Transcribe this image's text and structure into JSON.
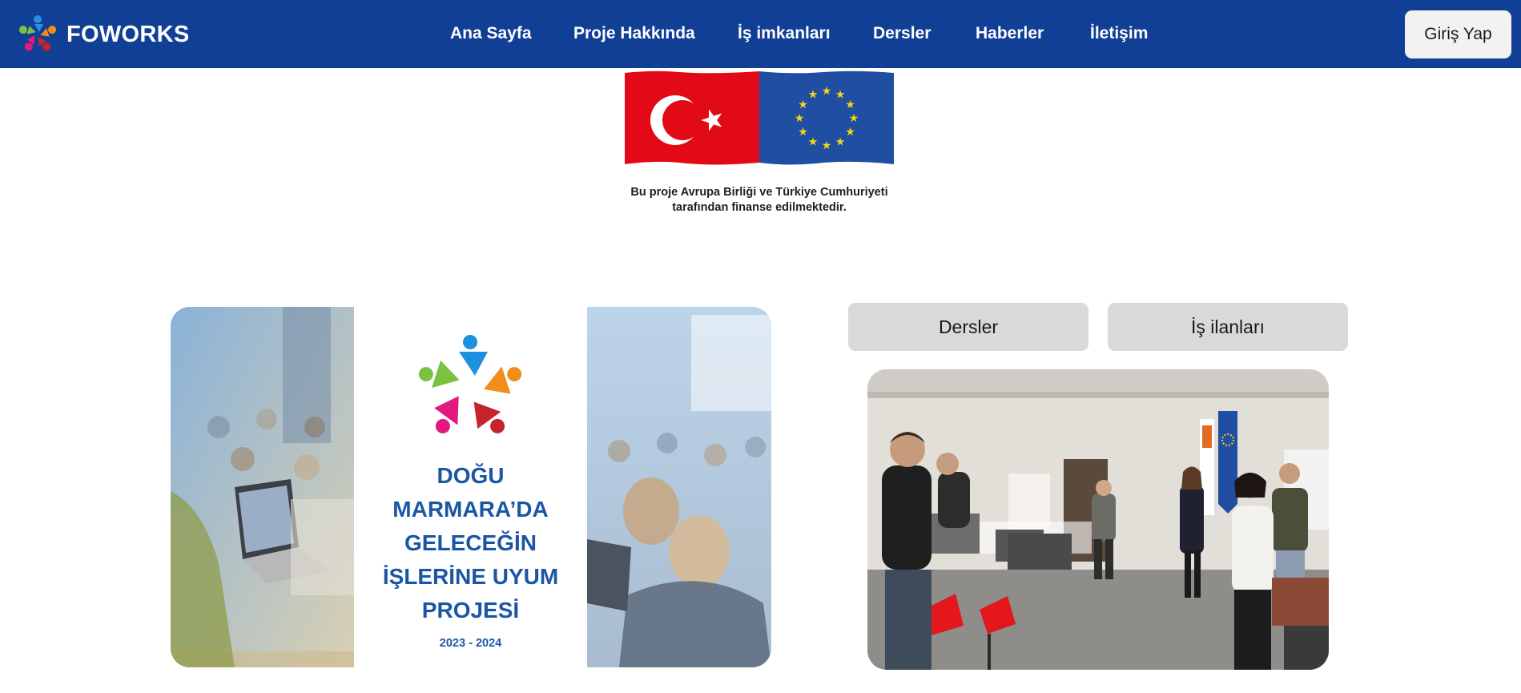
{
  "header": {
    "brand_name": "FOWORKS",
    "nav": [
      {
        "label": "Ana Sayfa"
      },
      {
        "label": "Proje Hakkında"
      },
      {
        "label": "İş imkanları"
      },
      {
        "label": "Dersler"
      },
      {
        "label": "Haberler"
      },
      {
        "label": "İletişim"
      }
    ],
    "login_label": "Giriş Yap"
  },
  "funding": {
    "note_line1": "Bu proje Avrupa Birliği ve Türkiye Cumhuriyeti",
    "note_line2": "tarafından finanse edilmektedir."
  },
  "hero": {
    "title_lines": [
      "DOĞU",
      "MARMARA’DA",
      "GELECEĞİN",
      "İŞLERİNE UYUM",
      "PROJESİ"
    ],
    "years": "2023 - 2024"
  },
  "tabs": [
    {
      "label": "Dersler"
    },
    {
      "label": "İş ilanları"
    }
  ],
  "colors": {
    "navbar": "#123f96",
    "tab_bg": "#d9d9d9",
    "hero_text": "#1b56a6",
    "flag_red": "#e30a17",
    "eu_blue": "#1f4ea3",
    "eu_star": "#f7d417"
  }
}
